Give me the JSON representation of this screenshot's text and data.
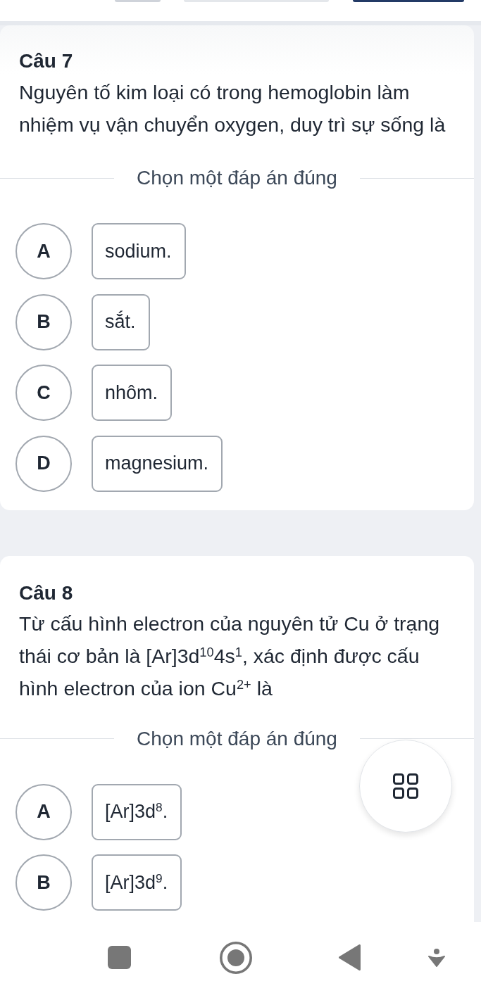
{
  "questions": [
    {
      "title": "Câu 7",
      "text": "Nguyên tố kim loại có trong hemoglobin làm nhiệm vụ vận chuyển oxygen, duy trì sự sống là",
      "prompt": "Chọn một đáp án đúng",
      "options": [
        {
          "letter": "A",
          "text": "sodium.",
          "selected": false
        },
        {
          "letter": "B",
          "text": "sắt.",
          "selected": false
        },
        {
          "letter": "C",
          "text": "nhôm.",
          "selected": false
        },
        {
          "letter": "D",
          "text": "magnesium.",
          "selected": false
        }
      ]
    },
    {
      "title": "Câu 8",
      "text": "Từ cấu hình electron của nguyên tử Cu ở trạng thái cơ bản là [Ar]3d$^{10}$4s$^{1}$, xác định được cấu hình electron của ion Cu$^{2+}$ là",
      "prompt": "Chọn một đáp án đúng",
      "options": [
        {
          "letter": "A",
          "text": "[Ar]3d$^{8}$.",
          "selected": false
        },
        {
          "letter": "B",
          "text": "[Ar]3d$^{9}$.",
          "selected": false
        }
      ]
    }
  ]
}
